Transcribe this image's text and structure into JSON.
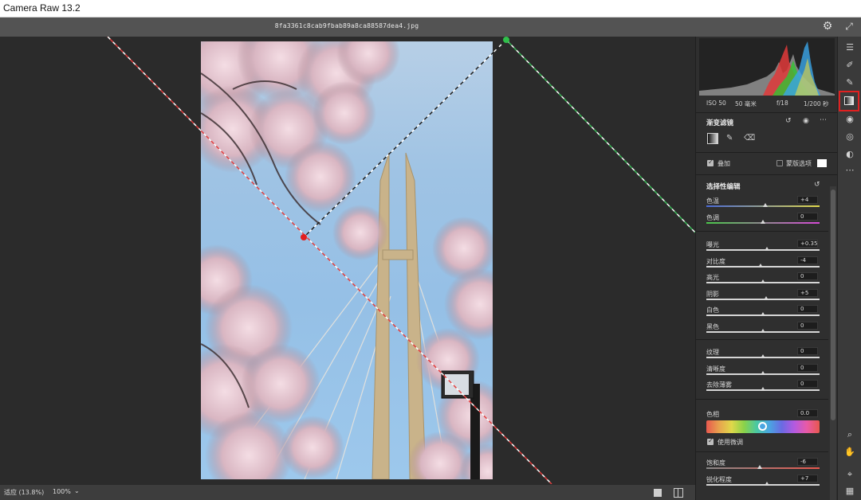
{
  "app": {
    "title": "Camera Raw 13.2"
  },
  "file": {
    "name": "8fa3361c8cab9fbab89a8ca88587dea4.jpg"
  },
  "exif": {
    "iso": "ISO 50",
    "focal": "50 毫米",
    "aperture": "f/18",
    "shutter": "1/200 秒"
  },
  "panel": {
    "header": "渐变滤镜",
    "overlay_label": "叠加",
    "overlay_checked": true,
    "mask_options_label": "蒙版选项",
    "section_title": "选择性编辑",
    "sliders_group1": [
      {
        "label": "色温",
        "value": "+4"
      },
      {
        "label": "色调",
        "value": "0"
      }
    ],
    "sliders_group2": [
      {
        "label": "曝光",
        "value": "+0.35"
      },
      {
        "label": "对比度",
        "value": "-4"
      },
      {
        "label": "高光",
        "value": "0"
      },
      {
        "label": "阴影",
        "value": "+5"
      },
      {
        "label": "白色",
        "value": "0"
      },
      {
        "label": "黑色",
        "value": "0"
      }
    ],
    "sliders_group3": [
      {
        "label": "纹理",
        "value": "0"
      },
      {
        "label": "清晰度",
        "value": "0"
      },
      {
        "label": "去除薄雾",
        "value": "0"
      }
    ],
    "hue": {
      "label": "色相",
      "value": "0.0",
      "fine_tune_label": "使用微调",
      "fine_tune_checked": true
    },
    "sliders_group4": [
      {
        "label": "饱和度",
        "value": "-6"
      },
      {
        "label": "锐化程度",
        "value": "+7"
      }
    ]
  },
  "statusbar": {
    "fit_label": "适应 (13.8%)",
    "zoom_label": "100%"
  },
  "toolrail": {
    "tools": [
      "edit-icon",
      "healing-icon",
      "brush-icon",
      "graduated-filter-icon",
      "radial-filter-icon",
      "red-eye-icon",
      "presets-icon",
      "more-icon",
      "zoom-icon",
      "hand-icon",
      "sampler-icon",
      "grid-icon"
    ],
    "active": "graduated-filter-icon"
  },
  "colors": {
    "accent_highlight": "#e02020",
    "panel_bg": "#2f2f2f",
    "canvas_bg": "#2b2b2b"
  }
}
